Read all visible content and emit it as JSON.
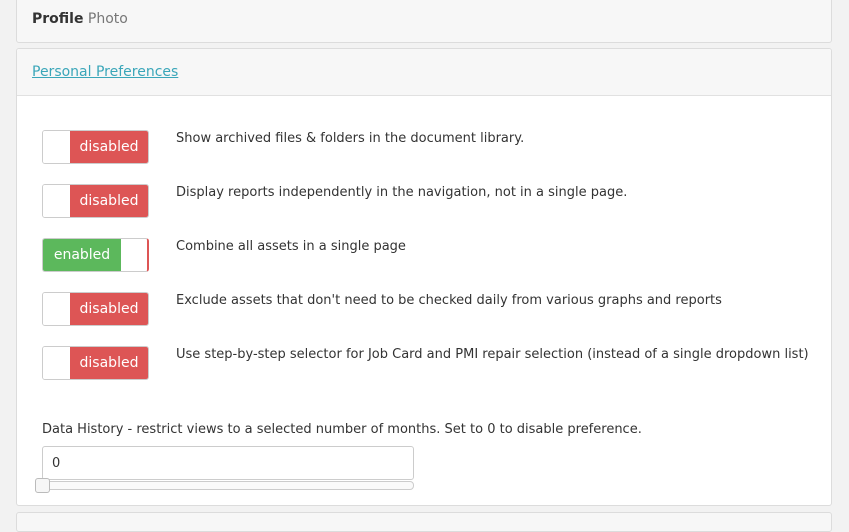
{
  "profile": {
    "title_bold": "Profile",
    "title_rest": "Photo"
  },
  "prefs": {
    "header": "Personal Preferences",
    "items": [
      {
        "state": "disabled",
        "text": "Show archived files & folders in the document library."
      },
      {
        "state": "disabled",
        "text": "Display reports independently in the navigation, not in a single page."
      },
      {
        "state": "enabled",
        "text": "Combine all assets in a single page"
      },
      {
        "state": "disabled",
        "text": "Exclude assets that don't need to be checked daily from various graphs and reports"
      },
      {
        "state": "disabled",
        "text": "Use step-by-step selector for Job Card and PMI repair selection (instead of a single dropdown list)"
      }
    ],
    "history": {
      "label": "Data History - restrict views to a selected number of months. Set to 0 to disable preference.",
      "value": "0",
      "slider_value": 0
    }
  }
}
